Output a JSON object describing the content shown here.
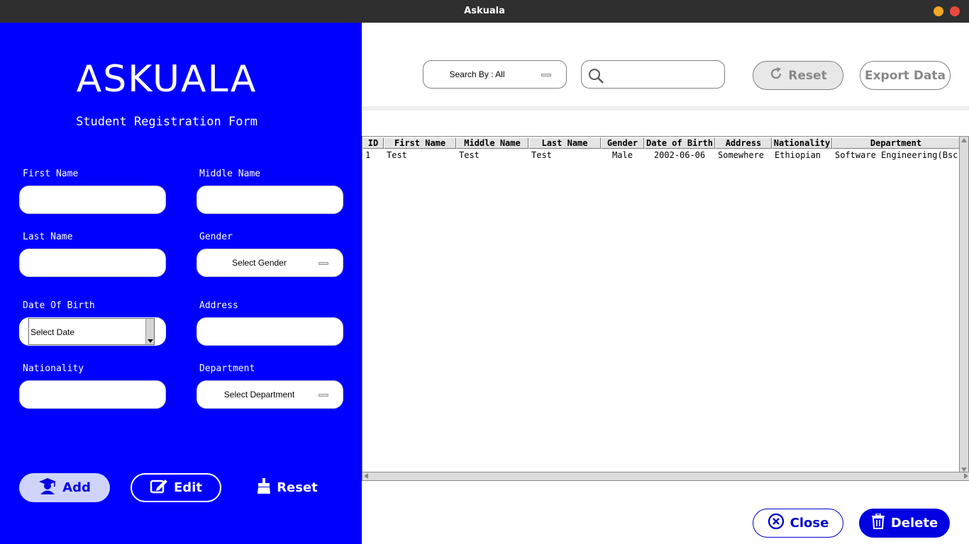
{
  "window": {
    "title": "Askuala"
  },
  "form": {
    "logo": "ASKUALA",
    "subtitle": "Student Registration Form",
    "labels": {
      "first_name": "First Name",
      "middle_name": "Middle Name",
      "last_name": "Last Name",
      "gender": "Gender",
      "dob": "Date Of Birth",
      "address": "Address",
      "nationality": "Nationality",
      "department": "Department"
    },
    "gender_select": "Select Gender",
    "date_select": "Select Date",
    "department_select": "Select Department",
    "buttons": {
      "add": "Add",
      "edit": "Edit",
      "reset": "Reset"
    }
  },
  "toolbar": {
    "search_by": "Search By : All",
    "search_value": "",
    "reset": "Reset",
    "export": "Export Data"
  },
  "table": {
    "columns": [
      "ID",
      "First Name",
      "Middle Name",
      "Last Name",
      "Gender",
      "Date of Birth",
      "Address",
      "Nationality",
      "Department"
    ],
    "rows": [
      [
        "1",
        "Test",
        "Test",
        "Test",
        "Male",
        "2002-06-06",
        "Somewhere",
        "Ethiopian",
        "Software Engineering(Bsc)"
      ]
    ]
  },
  "actions": {
    "close": "Close",
    "delete": "Delete"
  },
  "colors": {
    "panel": "#0000ff",
    "accent": "#0000e0"
  }
}
